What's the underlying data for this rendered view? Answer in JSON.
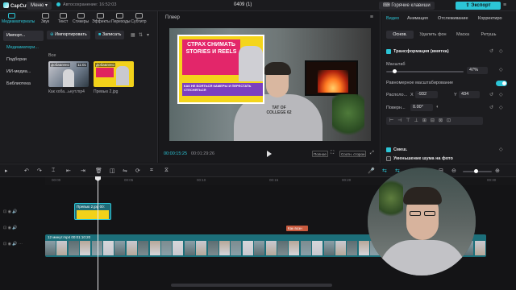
{
  "app": {
    "logo": "CapCut",
    "menu": "Меню",
    "autosave": "Автосохранение: 16:52:03",
    "title": "0409 (1)",
    "hotkeys": "Горячие клавиши",
    "export": "Экспорт"
  },
  "tools": [
    "Медиаматериалы",
    "Звук",
    "Текст",
    "Стикеры",
    "Эффекты",
    "Переходы",
    "Субтитр"
  ],
  "leftnav": [
    "Импорт...",
    "Медиаматери...",
    "Подборки",
    "ИИ-медиа...",
    "Библиотека"
  ],
  "media": {
    "import_btn": "Импортировать",
    "record_btn": "Записать",
    "all_label": "Все",
    "items": [
      {
        "caption": "Как хоба...ьнут.mp4",
        "duration": "11:01",
        "added": "Добавлено"
      },
      {
        "caption": "Превью 2.jpg",
        "duration": "",
        "added": "Добавлено"
      }
    ]
  },
  "player": {
    "title": "Плеер",
    "time_current": "00:00:15:25",
    "time_total": "00:01:29:26",
    "btn_full": "Полное",
    "btn_ratio": "Соотн. сторон",
    "video_headline": "СТРАХ СНИМАТЬ STORIES И REELS",
    "video_subline": "КАК НЕ БОЯТЬСЯ КАМЕРЫ И ПЕРЕСТАТЬ СТЕСНЯТЬСЯ",
    "hoodie_text": "TAT OF COLLEGE 62"
  },
  "right": {
    "tabs": [
      "Видео",
      "Анимация",
      "Отслеживание",
      "Корректиро"
    ],
    "subtabs": [
      "Основ.",
      "Удалить фон",
      "Маска",
      "Ретушь"
    ],
    "transform_title": "Трансформация (вмятка)",
    "scale_label": "Масштаб",
    "scale_value": "47%",
    "uniform_label": "Равномерное масштабирование",
    "pos_label": "Располо...",
    "pos_x_label": "X",
    "pos_x": "-932",
    "pos_y_label": "Y",
    "pos_y": "434",
    "rot_label": "Поверн...",
    "rot_value": "0.00°",
    "blend_label": "Смеш.",
    "denoise_label": "Уменьшение шума на фото"
  },
  "timeline": {
    "ticks": [
      "00:00",
      "00:05",
      "00:10",
      "00:15",
      "00:20",
      "00:25",
      "00:30"
    ],
    "clip_image_label": "Превью 2.jpg  00:",
    "clip_text_label": "Как возн",
    "clip_main_label": "12 минут.mp4  00:01:10:20"
  },
  "colors": {
    "accent": "#2cc5d6",
    "bg": "#141416",
    "panel": "#1c1c1f",
    "text_clip": "#c85a3e"
  }
}
